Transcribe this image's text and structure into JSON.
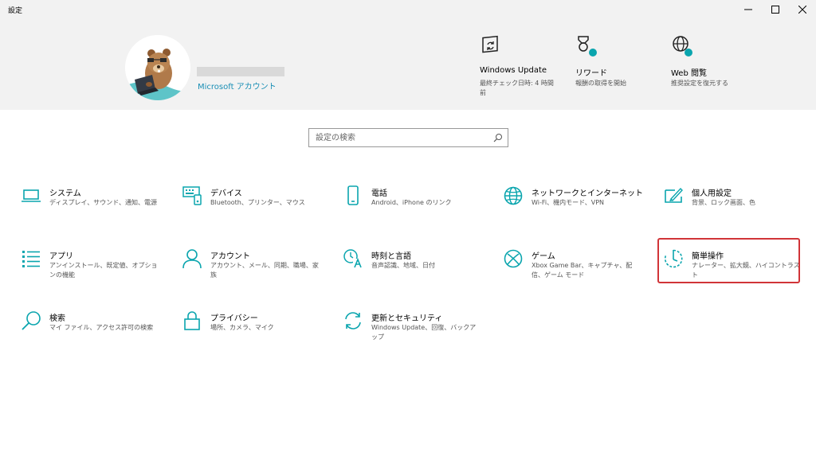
{
  "window": {
    "title": "設定"
  },
  "profile": {
    "account_link": "Microsoft アカウント"
  },
  "quick_tiles": [
    {
      "title": "Windows Update",
      "subtitle": "最終チェック日時: 4 時間前",
      "icon": "windows-update-icon"
    },
    {
      "title": "リワード",
      "subtitle": "報酬の取得を開始",
      "icon": "rewards-icon"
    },
    {
      "title": "Web 閲覧",
      "subtitle": "推奨設定を復元する",
      "icon": "web-browsing-icon"
    }
  ],
  "search": {
    "placeholder": "設定の検索",
    "value": ""
  },
  "categories": [
    {
      "title": "システム",
      "subtitle": "ディスプレイ、サウンド、通知、電源",
      "icon": "laptop-icon"
    },
    {
      "title": "デバイス",
      "subtitle": "Bluetooth、プリンター、マウス",
      "icon": "devices-icon"
    },
    {
      "title": "電話",
      "subtitle": "Android、iPhone のリンク",
      "icon": "phone-icon"
    },
    {
      "title": "ネットワークとインターネット",
      "subtitle": "Wi-Fi、機内モード、VPN",
      "icon": "globe-icon"
    },
    {
      "title": "個人用設定",
      "subtitle": "背景、ロック画面、色",
      "icon": "personalization-icon"
    },
    {
      "title": "アプリ",
      "subtitle": "アンインストール、既定値、オプションの機能",
      "icon": "apps-list-icon"
    },
    {
      "title": "アカウント",
      "subtitle": "アカウント、メール、同期、職場、家族",
      "icon": "person-icon"
    },
    {
      "title": "時刻と言語",
      "subtitle": "音声認識、地域、日付",
      "icon": "time-language-icon"
    },
    {
      "title": "ゲーム",
      "subtitle": "Xbox Game Bar、キャプチャ、配信、ゲーム モード",
      "icon": "xbox-icon"
    },
    {
      "title": "簡単操作",
      "subtitle": "ナレーター、拡大鏡、ハイコントラスト",
      "icon": "ease-of-access-icon"
    },
    {
      "title": "検索",
      "subtitle": "マイ ファイル、アクセス許可の検索",
      "icon": "search-icon"
    },
    {
      "title": "プライバシー",
      "subtitle": "場所、カメラ、マイク",
      "icon": "lock-icon"
    },
    {
      "title": "更新とセキュリティ",
      "subtitle": "Windows Update、回復、バックアップ",
      "icon": "update-security-icon"
    }
  ],
  "colors": {
    "accent": "#0aa5ae",
    "link": "#1a8fb5",
    "highlight_border": "#d13438",
    "header_background": "#f2f2f2"
  }
}
